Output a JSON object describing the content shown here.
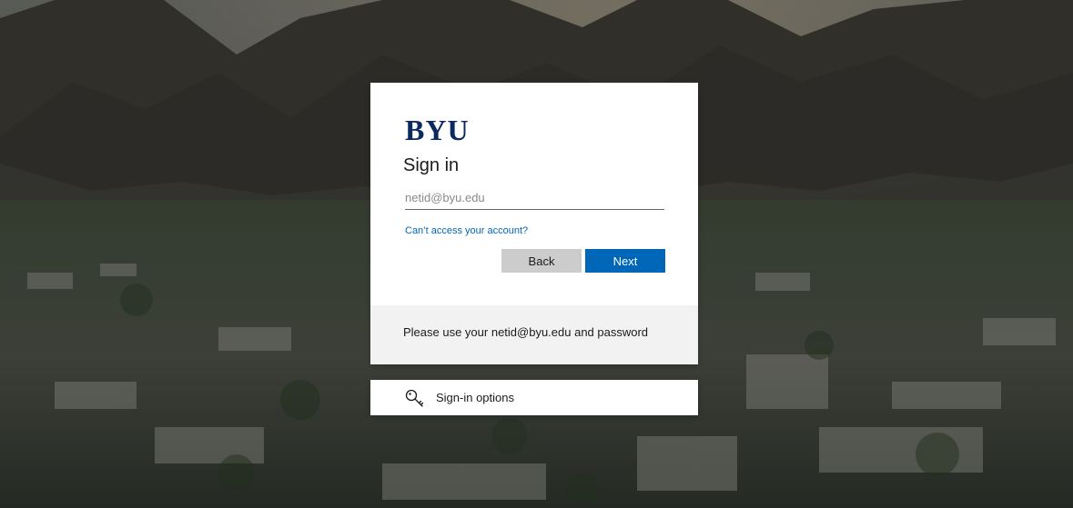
{
  "brand": {
    "logo_text": "BYU",
    "logo_color": "#0b2a60"
  },
  "signin": {
    "title": "Sign in",
    "email_placeholder": "netid@byu.edu",
    "email_value": "",
    "help_link": "Can’t access your account?",
    "back_label": "Back",
    "next_label": "Next",
    "footer_text": "Please use your netid@byu.edu and password"
  },
  "options": {
    "label": "Sign-in options",
    "icon": "key-icon"
  },
  "colors": {
    "accent": "#0067b8",
    "back_button": "#cccccc",
    "footer_bg": "#f2f2f2"
  }
}
